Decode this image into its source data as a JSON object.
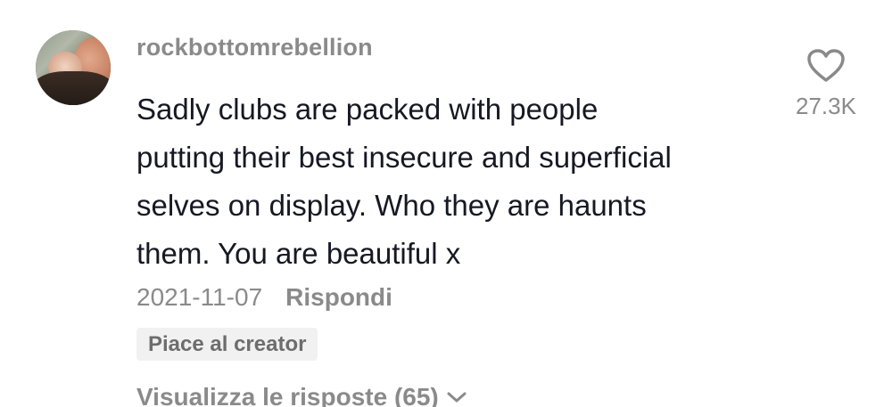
{
  "comment": {
    "username": "rockbottomrebellion",
    "text_lines": [
      "Sadly clubs are packed with people",
      "putting their best insecure and superficial",
      "selves on display. Who they are haunts",
      "them. You are beautiful x"
    ],
    "date": "2021-11-07",
    "reply_label": "Rispondi",
    "creator_badge": "Piace al creator",
    "view_replies_label": "Visualizza le risposte (65)",
    "like_count": "27.3K"
  },
  "icons": {
    "like": "heart-outline-icon",
    "expand": "chevron-down-icon"
  },
  "colors": {
    "text_primary": "#161823",
    "text_secondary": "#8a8a8a",
    "badge_bg": "#f1f1f2"
  }
}
